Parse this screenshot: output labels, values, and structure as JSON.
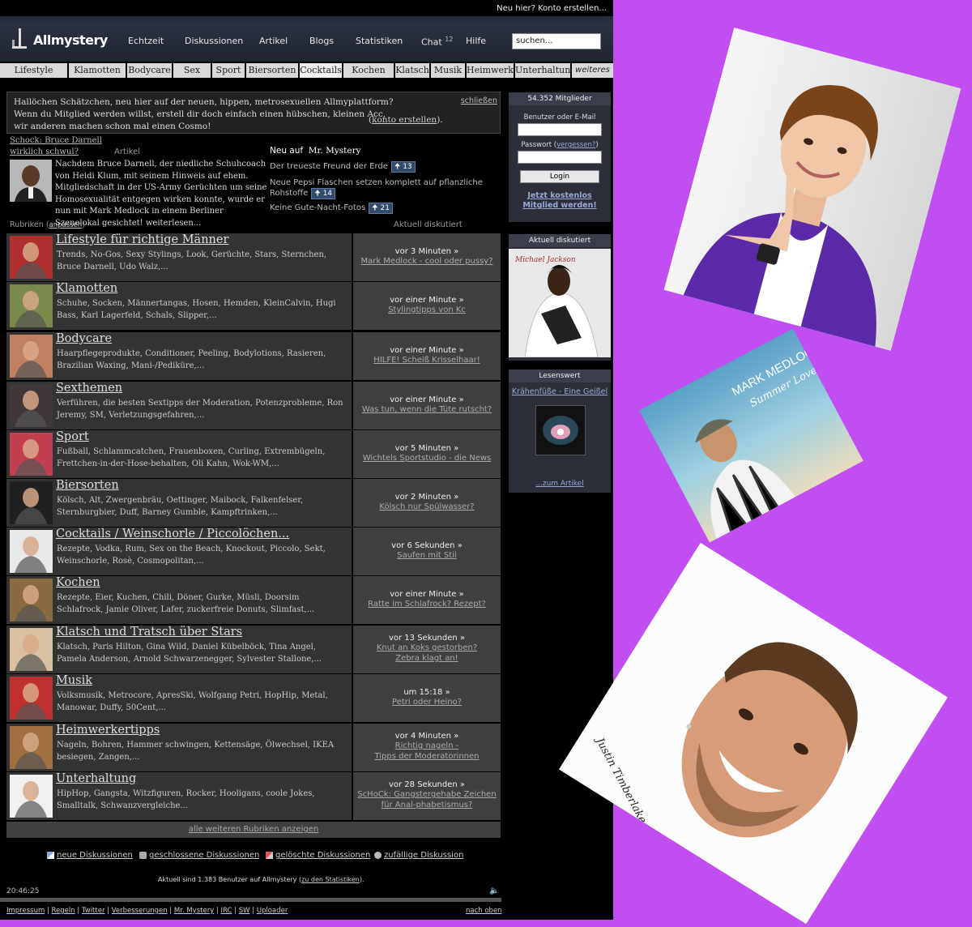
{
  "topbar": {
    "register_link": "Neu hier? Konto erstellen..."
  },
  "header": {
    "logo": "Allmystery",
    "nav": [
      {
        "label": "Echtzeit",
        "badge": ""
      },
      {
        "label": "Diskussionen",
        "badge": ""
      },
      {
        "label": "Artikel",
        "badge": ""
      },
      {
        "label": "Blogs",
        "badge": ""
      },
      {
        "label": "Statistiken",
        "badge": ""
      },
      {
        "label": "Chat",
        "badge": "12"
      },
      {
        "label": "Hilfe",
        "badge": ""
      }
    ],
    "search_value": "suchen..."
  },
  "categories": [
    "Lifestyle",
    "Klamotten",
    "Bodycare",
    "Sex",
    "Sport",
    "Biersorten",
    "Cocktails",
    "Kochen",
    "Klatsch",
    "Musik",
    "Heimwerk",
    "Unterhaltung",
    "weiteres"
  ],
  "welcome": {
    "line1": "Hallöchen Schätzchen, neu hier auf der neuen, hippen, metrosexuellen Allmyplattform?",
    "line2": "Wenn du Mitglied werden willst, erstell dir doch einfach einen hübschen, kleinen Acc,",
    "line2_link": "konto erstellen",
    "line3": "wir anderen machen schon mal einen Cosmo!",
    "close": "schließen"
  },
  "featured": {
    "link_line1": "Schock: Bruce Darnell",
    "link_line2": "wirklich schwul?",
    "type": "Artikel",
    "text": "Nachdem Bruce Darnell, der niedliche Schuhcoach von Heidi Klum, mit seinem Hinweis auf ehem. Mitgliedschaft in der US-Army Gerüchten um seine Homosexualität entgegen wirken konnte, wurde er nun mit Mark Medlock in einem Berliner Szenelokal gesichtet! weiterlesen..."
  },
  "news": {
    "head_prefix": "Neu auf",
    "head_site": "Mr. Mystery",
    "items": [
      {
        "text": "Der treueste Freund der Erde",
        "count": "13"
      },
      {
        "text": "Neue Pepsi Flaschen setzen komplett auf pflanzliche Rohstoffe",
        "count": "14"
      },
      {
        "text": "Keine Gute-Nacht-Fotos",
        "count": "21"
      }
    ]
  },
  "rubriken": {
    "label": "Rubriken",
    "adjust": "anpassen",
    "discussed_label": "Aktuell diskutiert"
  },
  "rows": [
    {
      "title": "Lifestyle für richtige Männer",
      "desc": "Trends, No-Gos, Sexy Stylings, Look, Gerüchte, Stars, Sternchen, Bruce Darnell, Udo Walz,...",
      "time": "vor 3 Minuten »",
      "link": [
        "Mark Medlock - cool oder pussy?"
      ],
      "color": "#b03030"
    },
    {
      "title": "Klamotten",
      "desc": "Schuhe, Socken, Männertangas, Hosen, Hemden, KleinCalvin, Hugi Bass, Karl Lagerfeld, Schals, Slipper,...",
      "time": "vor einer Minute »",
      "link": [
        "Stylingtipps von Kc"
      ],
      "color": "#7a8a4a"
    },
    {
      "title": "Bodycare",
      "desc": "Haarpflegeprodukte, Conditioner, Peeling, Bodylotions, Rasieren, Brazilian Waxing, Mani-/Pediküre,...",
      "time": "vor einer Minute »",
      "link": [
        "HILFE! Scheiß Krisselhaar!"
      ],
      "color": "#c08060"
    },
    {
      "title": "Sexthemen",
      "desc": "Verführen, die besten Sextipps der Moderation, Potenzprobleme, Ron Jeremy, SM, Verletzungsgefahren,...",
      "time": "vor einer Minute »",
      "link": [
        "Was tun, wenn die Tüte rutscht?"
      ],
      "color": "#403838"
    },
    {
      "title": "Sport",
      "desc": "Fußball, Schlammcatchen, Frauenboxen, Curling, Extrembügeln, Frettchen-in-der-Hose-behalten, Oli Kahn, Wok-WM,...",
      "time": "vor 5 Minuten »",
      "link": [
        "Wichtels Sportstudio - die News"
      ],
      "color": "#c04050"
    },
    {
      "title": "Biersorten",
      "desc": "Kölsch, Alt, Zwergenbräu, Oettinger, Maibock, Falkenfelser, Sternburgbier, Duff, Barney Gumble, Kampftrinken,...",
      "time": "vor 2 Minuten »",
      "link": [
        "Kölsch nur Spülwasser?"
      ],
      "color": "#202020"
    },
    {
      "title": "Cocktails / Weinschorle / Piccolöchen...",
      "desc": "Rezepte, Vodka, Rum, Sex on the Beach, Knockout, Piccolo, Sekt, Weinschorle, Rosè, Cosmopolitan,...",
      "time": "vor 6 Sekunden »",
      "link": [
        "Saufen mit Stil"
      ],
      "color": "#e8e8e8"
    },
    {
      "title": "Kochen",
      "desc": "Rezepte, Eier, Kuchen, Chili, Döner, Gurke, Müsli, Doorsim Schlafrock, Jamie Oliver, Lafer, zuckerfreie Donuts, Slimfast,...",
      "time": "vor einer Minute »",
      "link": [
        "Ratte im Schlafrock? Rezept?"
      ],
      "color": "#8a6a40"
    },
    {
      "title": "Klatsch und Tratsch über Stars",
      "desc": "Klatsch, Paris Hilton, Gina Wild, Daniel Kübelböck, Tina Angel, Pamela Anderson, Arnold Schwarzenegger, Sylvester Stallone,...",
      "time": "vor 13 Sekunden »",
      "link": [
        "Knut an Koks gestorben?",
        "Zebra klagt an!"
      ],
      "color": "#d8c0a0"
    },
    {
      "title": "Musik",
      "desc": "Volksmusik, Metrocore, ApresSki, Wolfgang Petri, HopHip, Metal, Manowar, Duffy, 50Cent,...",
      "time": "um 15:18 »",
      "link": [
        "Petri oder Heino?"
      ],
      "color": "#c03030"
    },
    {
      "title": "Heimwerkertipps",
      "desc": "Nageln, Bohren, Hammer schwingen, Kettensäge, Ölwechsel, IKEA besiegen, Zangen,...",
      "time": "vor 4 Minuten »",
      "link": [
        "Richtig nageln -",
        "Tipps der Moderatorinnen"
      ],
      "color": "#a07040"
    },
    {
      "title": "Unterhaltung",
      "desc": "HipHop, Gangsta, Witzfiguren, Rocker, Hooligans, coole Jokes, Smalltalk, Schwanzvergleiche...",
      "time": "vor 28 Sekunden »",
      "link": [
        "ScHoCk: Gangstergehabe Zeichen",
        "für Anal-phabetismus?"
      ],
      "color": "#f0f0f0"
    }
  ],
  "all_rubriken": "alle weiteren Rubriken anzeigen",
  "footer_links": [
    "neue Diskussionen",
    "geschlossene Diskussionen",
    "gelöschte Diskussionen",
    "zufällige Diskussion"
  ],
  "online": {
    "text": "Aktuell sind 1.383 Benutzer auf Allmystery (",
    "link": "zu den Statistiken",
    "close": ")."
  },
  "clock": "20:46:25",
  "bottom_links": [
    "Impressum",
    "Regeln",
    "Twitter",
    "Verbesserungen",
    "Mr. Mystery",
    "IRC",
    "SW",
    "Uploader"
  ],
  "to_top": "nach oben",
  "sidebar": {
    "members": "54.352 Mitglieder",
    "user_label": "Benutzer oder E-Mail",
    "pass_label": "Passwort (",
    "pass_link": "vergessen?",
    "pass_close": ")",
    "login": "Login",
    "cta_line1": "Jetzt kostenlos",
    "cta_line2": "Mitglied werden!",
    "discussed_head": "Aktuell diskutiert",
    "read_head": "Lesenswert",
    "read_link": "Krähenfüße - Eine Geißel",
    "read_more": "...zum Artikel"
  },
  "overlay": {
    "signature": "Justin Timberlake",
    "album_artist": "MARK MEDLOCK",
    "album_title": "Summer Love"
  },
  "colors": {
    "background": "#c04ef0",
    "page": "#000000",
    "row": "#333333",
    "row_right": "#404040"
  }
}
